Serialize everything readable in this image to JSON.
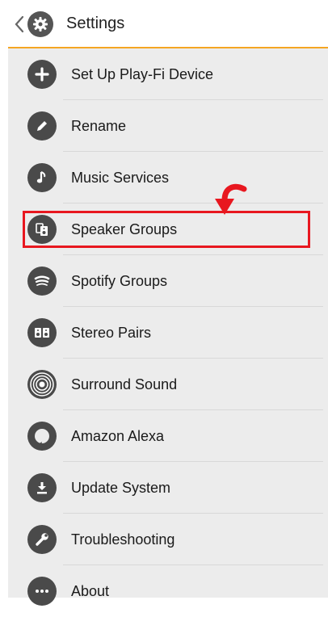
{
  "header": {
    "title": "Settings",
    "back_icon": "chevron-left-icon",
    "app_icon": "gear-icon",
    "accent_color": "#f5a623"
  },
  "menu": [
    {
      "label": "Set Up Play-Fi Device",
      "icon": "plus-icon"
    },
    {
      "label": "Rename",
      "icon": "pencil-icon"
    },
    {
      "label": "Music Services",
      "icon": "music-note-icon"
    },
    {
      "label": "Speaker Groups",
      "icon": "speaker-group-icon"
    },
    {
      "label": "Spotify Groups",
      "icon": "spotify-icon"
    },
    {
      "label": "Stereo Pairs",
      "icon": "stereo-pair-icon"
    },
    {
      "label": "Surround Sound",
      "icon": "surround-sound-icon"
    },
    {
      "label": "Amazon Alexa",
      "icon": "alexa-icon"
    },
    {
      "label": "Update System",
      "icon": "download-icon"
    },
    {
      "label": "Troubleshooting",
      "icon": "wrench-icon"
    },
    {
      "label": "About",
      "icon": "ellipsis-icon"
    }
  ],
  "annotation": {
    "highlighted_item": "Speaker Groups",
    "color": "#e8171f"
  }
}
